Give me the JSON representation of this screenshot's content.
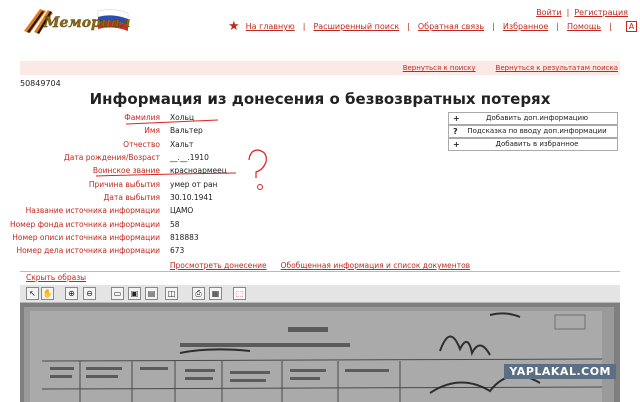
{
  "header": {
    "logo_text": "Мемориал",
    "nav": [
      {
        "label": "На главную"
      },
      {
        "label": "Расширенный поиск"
      },
      {
        "label": "Обратная связь"
      },
      {
        "label": "Избранное"
      },
      {
        "label": "Помощь"
      }
    ],
    "font_sizes": [
      "А",
      "А",
      "А"
    ],
    "top_links": {
      "login": "Войти",
      "register": "Регистрация"
    }
  },
  "back_links": {
    "search": "Вернуться к поиску",
    "results": "Вернуться к результатам поиска"
  },
  "record_id": "50849704",
  "title": "Информация из донесения о безвозвратных потерях",
  "fields": [
    {
      "label": "Фамилия",
      "value": "Хольц"
    },
    {
      "label": "Имя",
      "value": "Вальтер"
    },
    {
      "label": "Отчество",
      "value": "Хальт"
    },
    {
      "label": "Дата рождения/Возраст",
      "value": "__.__.1910"
    },
    {
      "label": "Воинское звание",
      "value": "красноармеец"
    },
    {
      "label": "Причина выбытия",
      "value": "умер от ран"
    },
    {
      "label": "Дата выбытия",
      "value": "30.10.1941"
    },
    {
      "label": "Название источника информации",
      "value": "ЦАМО"
    },
    {
      "label": "Номер фонда источника информации",
      "value": "58"
    },
    {
      "label": "Номер описи источника информации",
      "value": "818883"
    },
    {
      "label": "Номер дела источника информации",
      "value": "673"
    }
  ],
  "actions": [
    {
      "icon": "+",
      "label": "Добавить доп.информацию"
    },
    {
      "icon": "?",
      "label": "Подсказка по вводу доп.информации"
    },
    {
      "icon": "+",
      "label": "Добавить в избранное"
    }
  ],
  "mid_links": {
    "view": "Просмотреть донесение",
    "summary": "Обобщенная информация и список документов"
  },
  "hide_images": "Скрыть образы",
  "watermark": "YAPLAKAL.COM",
  "colors": {
    "accent": "#c1281e",
    "pink_bar": "#fbe9e5",
    "viewer_bg": "#8e8e8e"
  }
}
